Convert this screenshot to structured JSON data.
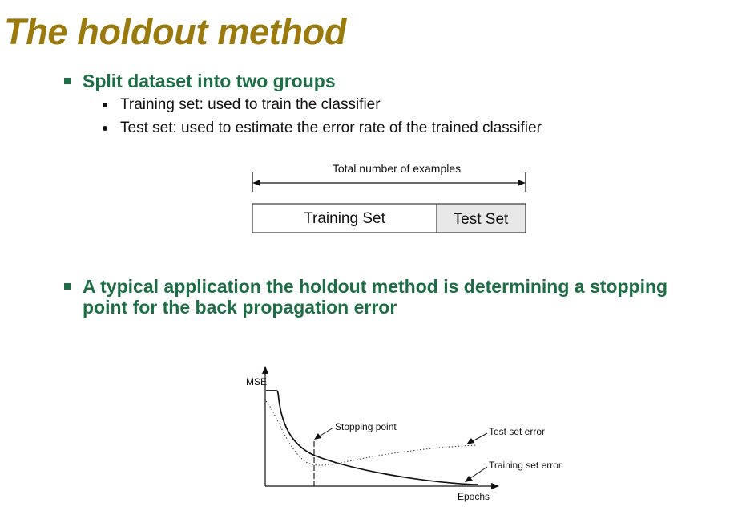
{
  "slide": {
    "title": "The holdout method",
    "bullet1": {
      "text": "Split dataset into two groups",
      "subbullets": [
        "Training set: used to train the classifier",
        "Test set: used to estimate the error rate of the trained classifier"
      ]
    },
    "bullet2": {
      "lines": [
        "A typical application the holdout method is determining a stopping",
        "point for the back propagation error"
      ]
    }
  },
  "split_diagram": {
    "total_label": "Total number of examples",
    "training_label": "Training Set",
    "test_label": "Test Set"
  },
  "error_chart": {
    "y_axis_label": "MSE",
    "x_axis_label": "Epochs",
    "stopping_point_label": "Stopping point",
    "test_error_label": "Test set error",
    "training_error_label": "Training set error"
  },
  "colors": {
    "title": "#9a7a0c",
    "heading": "#1c6e45",
    "test_box_fill": "#e8e8e8"
  }
}
